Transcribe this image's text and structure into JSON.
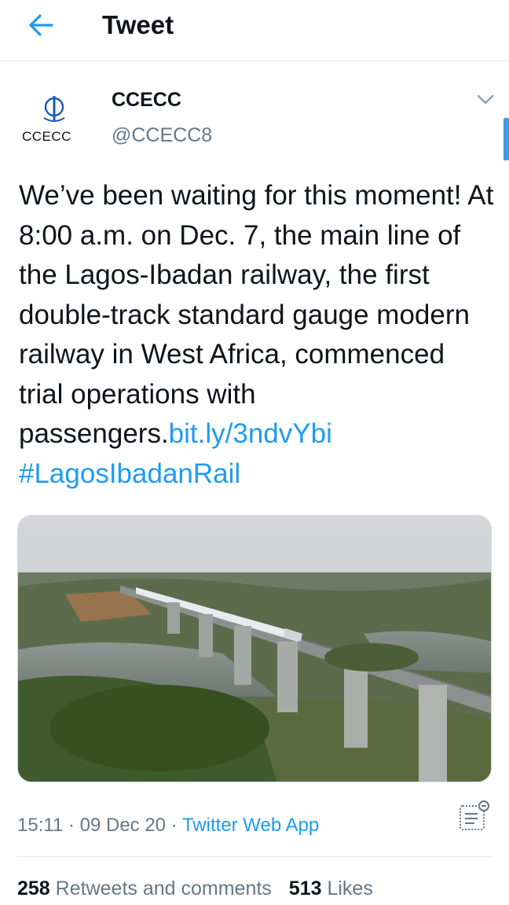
{
  "header": {
    "title": "Tweet",
    "back_icon": "arrow-left-icon"
  },
  "author": {
    "avatar_label": "CCECC",
    "display_name": "CCECC",
    "handle": "@CCECC8"
  },
  "tweet": {
    "text": "We’ve been waiting for this moment! At 8:00 a.m. on Dec. 7, the main line of the Lagos-Ibadan railway, the first double-track standard gauge modern railway in West Africa, commenced trial operations with passengers.",
    "link": "bit.ly/3ndvYbi",
    "hashtag": "#LagosIbadanRail"
  },
  "meta": {
    "time": "15:11",
    "sep1": "·",
    "date": "09 Dec 20",
    "sep2": "·",
    "source": "Twitter Web App"
  },
  "stats": {
    "retweets_count": "258",
    "retweets_label": "Retweets and comments",
    "likes_count": "513",
    "likes_label": "Likes"
  },
  "colors": {
    "accent": "#1d9bf0",
    "muted": "#657786",
    "text": "#0f1419"
  }
}
